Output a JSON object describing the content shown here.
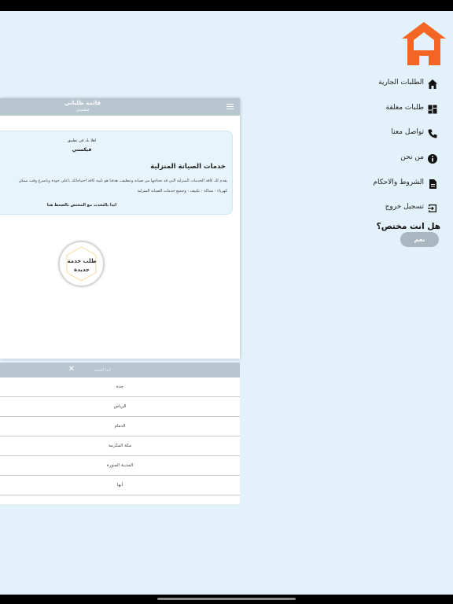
{
  "colors": {
    "accent": "#f26522",
    "app_bar": "#b8c6d0",
    "background": "#e3f2fa"
  },
  "app_bar": {
    "title": "قائمة طلباتي",
    "subtitle": "فيكسني"
  },
  "welcome": {
    "line": "اهلا بك في تطبيق",
    "app_name": "فيكسني",
    "heading": "خدمات الصيانة المنزلية",
    "description_line1": "يقدم لك كافة الخدمات المنزلية التي قد تحتاجها من صيانة وتنظيف، هدفنا هو تلبية كافة احتياجاتك باعلى جودة وباسرع وقت ممكن",
    "description_line2": "كهرباء - سباكة - تكييف - وجميع خدمات الصيانة المنزلية",
    "chat_link": "ابدا بالتحدث مع المختص بالضغط هنا"
  },
  "new_request": {
    "line1": "طلب خدمة",
    "line2": "جديدة"
  },
  "city_picker": {
    "search_placeholder": "ابدأ البحث",
    "cities": [
      "جدة",
      "الرياض",
      "الدمام",
      "مكة المكرمة",
      "المدينة المنورة",
      "أبها"
    ]
  },
  "drawer": {
    "items": [
      {
        "label": "الطلبات الجارية",
        "icon": "home-icon"
      },
      {
        "label": "طلبات مغلقة",
        "icon": "dashboard-icon"
      },
      {
        "label": "تواصل معنا",
        "icon": "phone-icon"
      },
      {
        "label": "من نحن",
        "icon": "info-icon"
      },
      {
        "label": "الشروط والاحكام",
        "icon": "document-icon"
      },
      {
        "label": "تسجيل خروج",
        "icon": "logout-icon"
      }
    ],
    "expert_question": "هل انت مختص؟",
    "yes_button": "نعم"
  }
}
